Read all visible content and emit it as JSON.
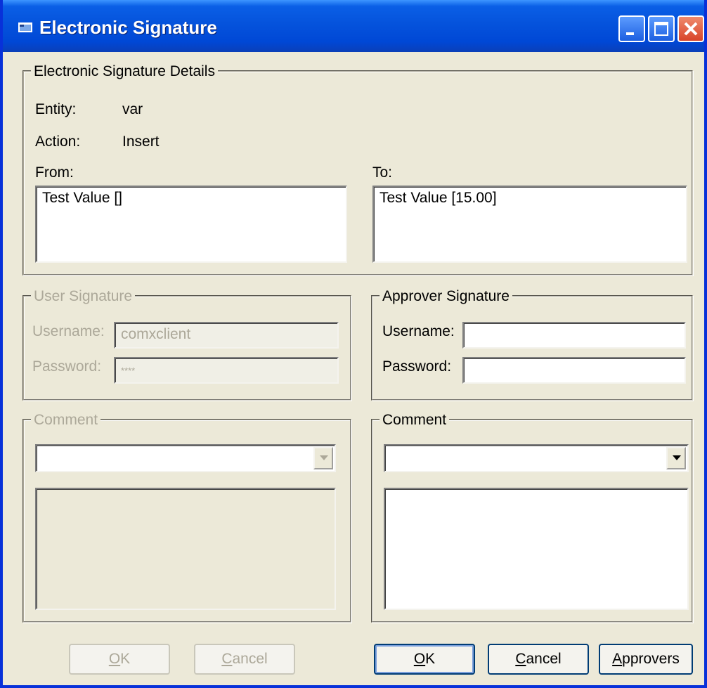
{
  "window": {
    "title": "Electronic Signature"
  },
  "details": {
    "legend": "Electronic Signature Details",
    "entity_label": "Entity:",
    "entity_value": "var",
    "action_label": "Action:",
    "action_value": "Insert",
    "from_label": "From:",
    "from_value": "Test Value []",
    "to_label": "To:",
    "to_value": "Test Value [15.00]"
  },
  "user_signature": {
    "legend": "User Signature",
    "username_label": "Username:",
    "username_value": "comxclient",
    "password_label": "Password:",
    "password_value": "****"
  },
  "approver_signature": {
    "legend": "Approver Signature",
    "username_label": "Username:",
    "username_value": "",
    "password_label": "Password:",
    "password_value": ""
  },
  "user_comment": {
    "legend": "Comment",
    "selected": "",
    "text": ""
  },
  "approver_comment": {
    "legend": "Comment",
    "selected": "",
    "text": ""
  },
  "buttons": {
    "user_ok": {
      "mnemonic": "O",
      "rest": "K"
    },
    "user_cancel": {
      "mnemonic": "C",
      "rest": "ancel"
    },
    "approver_ok": {
      "mnemonic": "O",
      "rest": "K"
    },
    "approver_cancel": {
      "mnemonic": "C",
      "rest": "ancel"
    },
    "approvers": {
      "mnemonic": "A",
      "rest": "pprovers"
    }
  }
}
